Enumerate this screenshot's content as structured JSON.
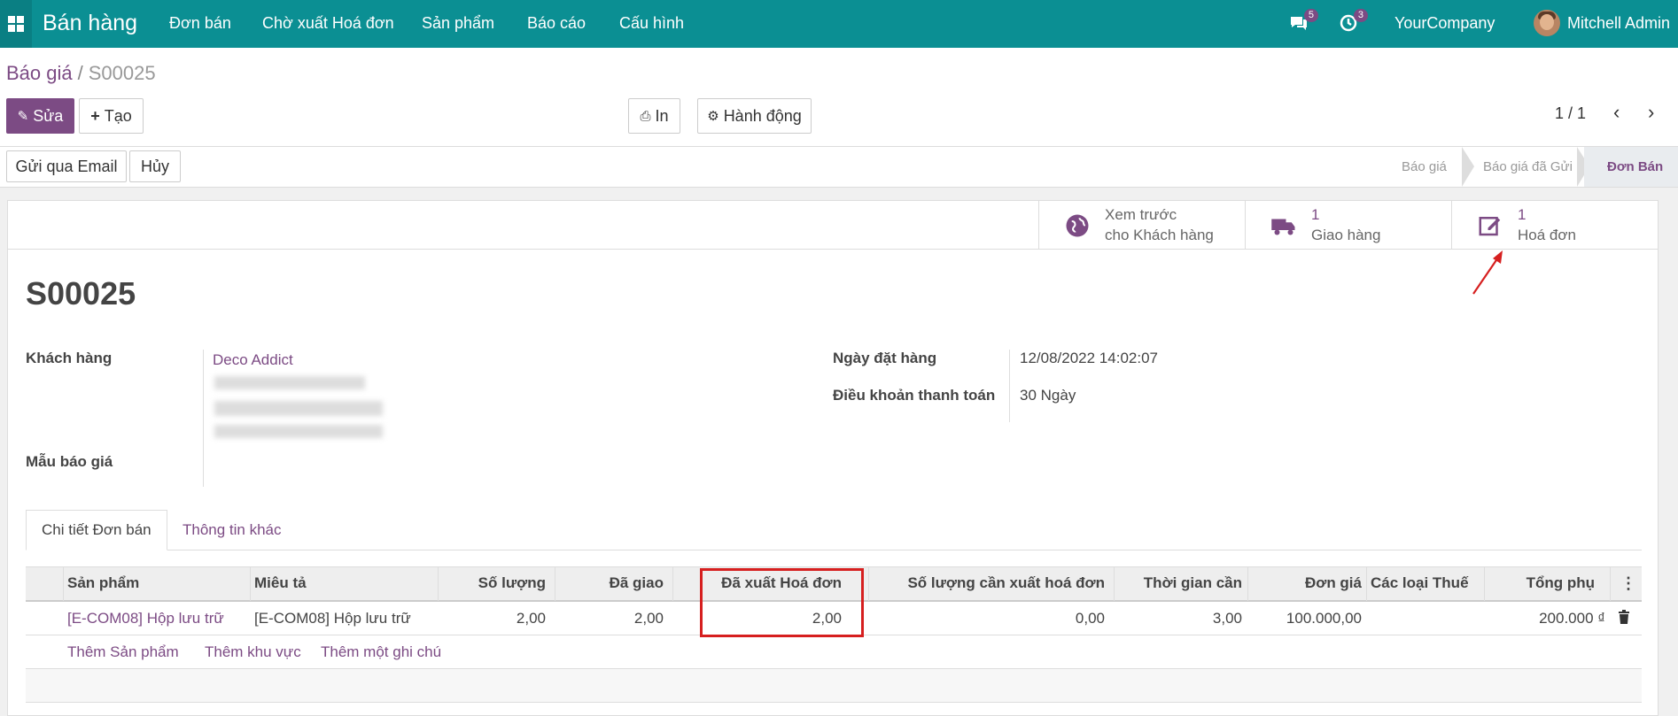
{
  "navbar": {
    "app_name": "Bán hàng",
    "menu": [
      "Đơn bán",
      "Chờ xuất Hoá đơn",
      "Sản phẩm",
      "Báo cáo",
      "Cấu hình"
    ],
    "messages_badge": "5",
    "activities_badge": "3",
    "company": "YourCompany",
    "user": "Mitchell Admin"
  },
  "breadcrumb": {
    "parent": "Báo giá",
    "separator": "/",
    "current": "S00025"
  },
  "toolbar": {
    "edit_label": "Sửa",
    "create_label": "Tạo",
    "print_label": "In",
    "action_label": "Hành động",
    "pager": "1 / 1"
  },
  "statusbar": {
    "buttons": [
      "Gửi qua Email",
      "Hủy"
    ],
    "stages": [
      "Báo giá",
      "Báo giá đã Gửi",
      "Đơn Bán"
    ],
    "active_stage": "Đơn Bán"
  },
  "smart_buttons": {
    "preview": {
      "line1": "Xem trước",
      "line2": "cho Khách hàng"
    },
    "delivery": {
      "count": "1",
      "label": "Giao hàng"
    },
    "invoice": {
      "count": "1",
      "label": "Hoá đơn"
    }
  },
  "record": {
    "name": "S00025",
    "customer_label": "Khách hàng",
    "customer": "Deco Addict",
    "template_label": "Mẫu báo giá",
    "order_date_label": "Ngày đặt hàng",
    "order_date": "12/08/2022 14:02:07",
    "payment_terms_label": "Điều khoản thanh toán",
    "payment_terms": "30 Ngày"
  },
  "tabs": [
    "Chi tiết Đơn bán",
    "Thông tin khác"
  ],
  "order_lines": {
    "headers": [
      "Sản phẩm",
      "Miêu tả",
      "Số lượng",
      "Đã giao",
      "Đã xuất Hoá đơn",
      "Số lượng cần xuất hoá đơn",
      "Thời gian cần",
      "Đơn giá",
      "Các loại Thuế",
      "Tổng phụ"
    ],
    "rows": [
      {
        "product": "[E-COM08] Hộp lưu trữ",
        "description": "[E-COM08] Hộp lưu trữ",
        "qty": "2,00",
        "delivered": "2,00",
        "invoiced": "2,00",
        "to_invoice": "0,00",
        "lead_time": "3,00",
        "unit_price": "100.000,00",
        "taxes": "",
        "subtotal": "200.000 ₫"
      }
    ],
    "add_links": [
      "Thêm Sản phẩm",
      "Thêm khu vực",
      "Thêm một ghi chú"
    ]
  },
  "colors": {
    "navbar": "#0b8f93",
    "primary": "#7c4b84",
    "highlight": "#d61f1f"
  }
}
